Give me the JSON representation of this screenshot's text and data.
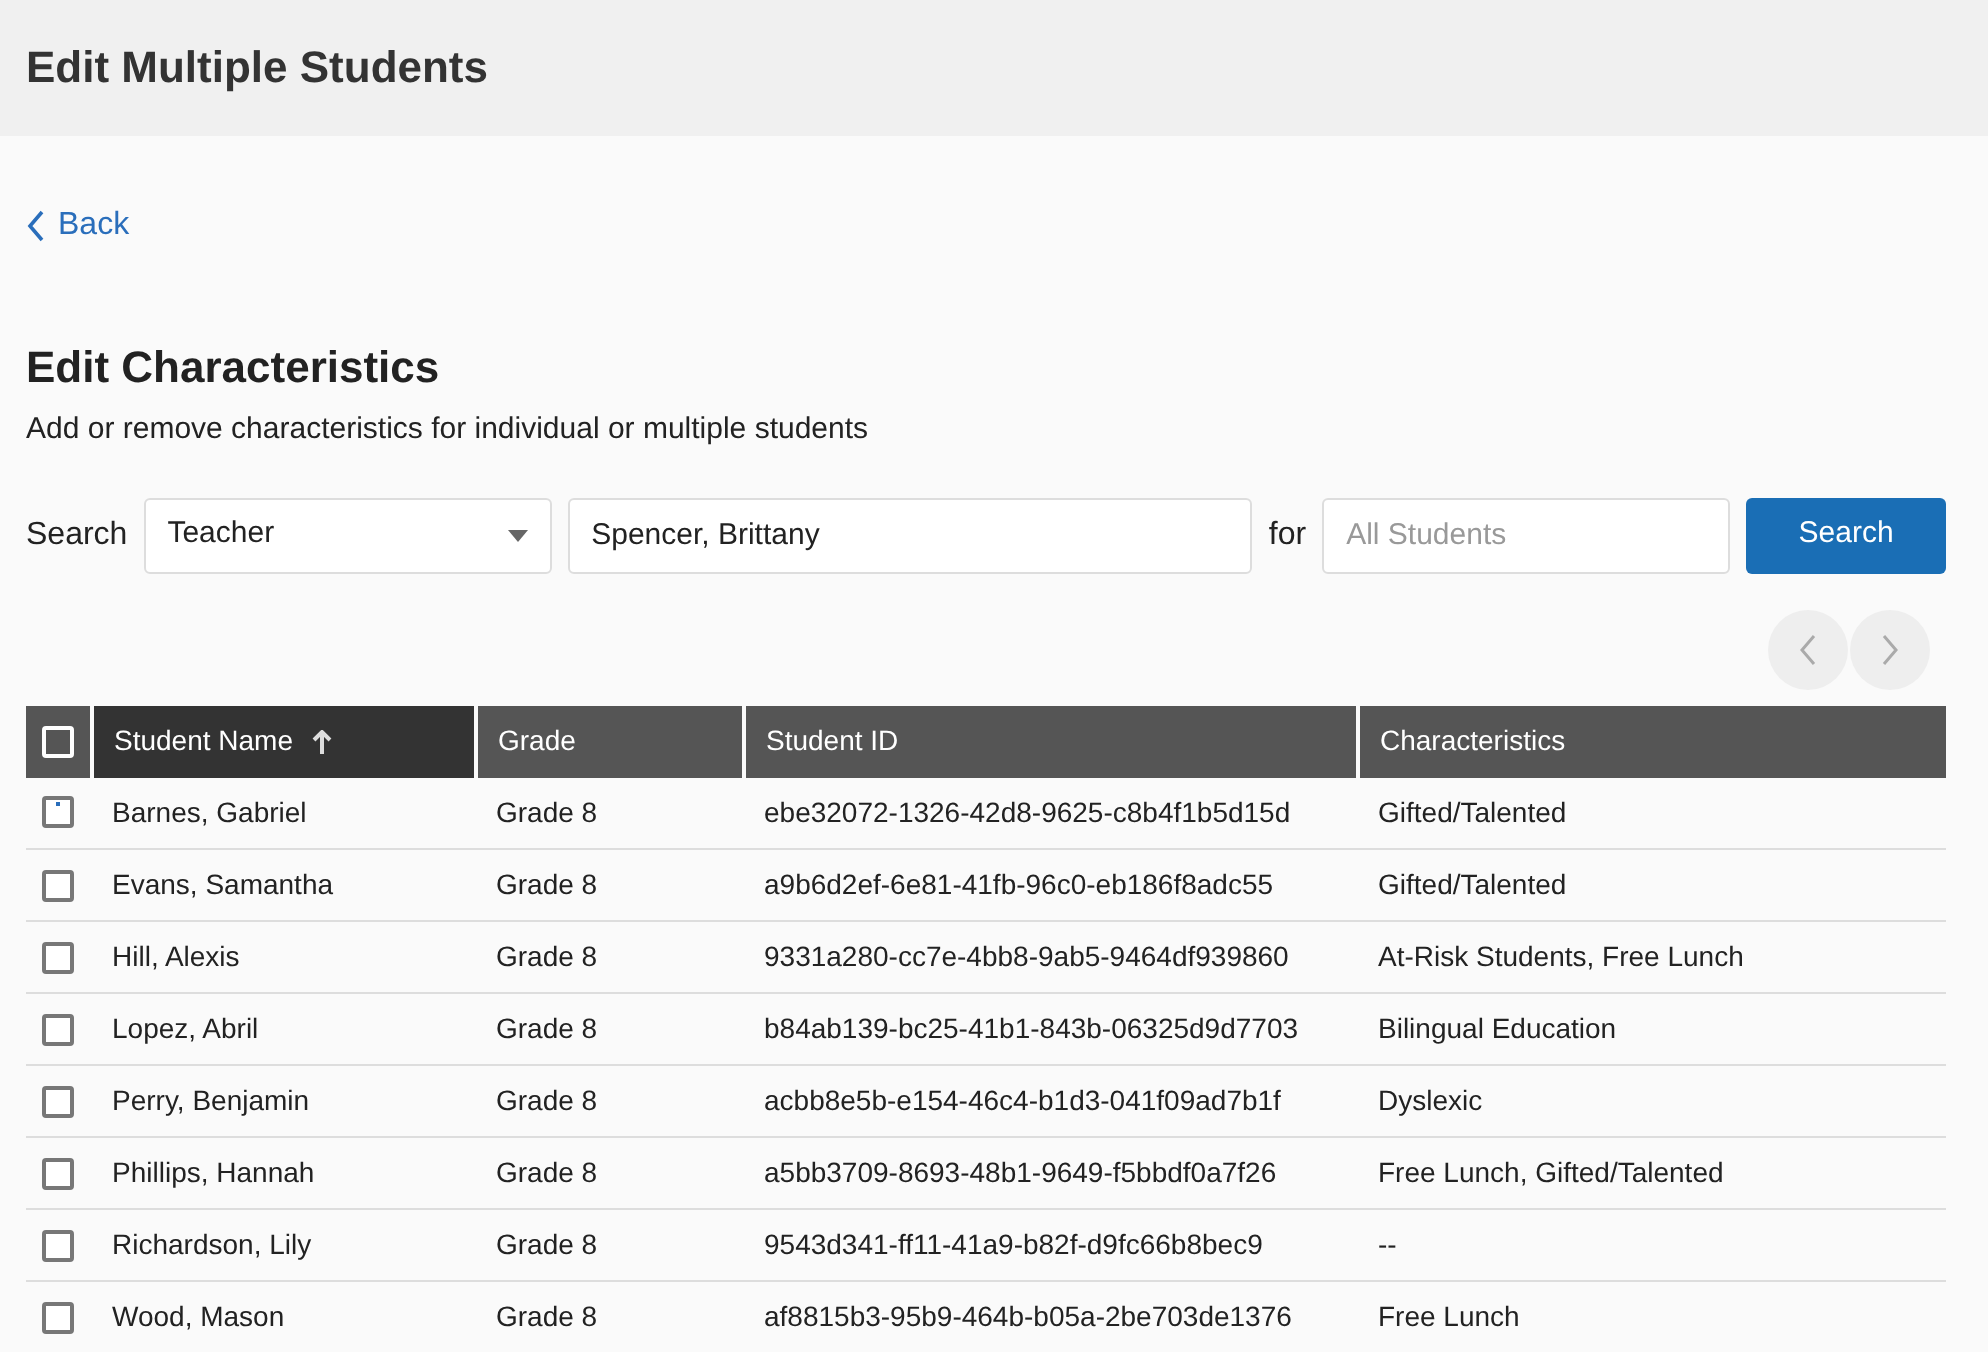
{
  "header": {
    "title": "Edit Multiple Students"
  },
  "back_link": "Back",
  "heading": "Edit Characteristics",
  "subtitle": "Add or remove characteristics for individual or multiple students",
  "search": {
    "label": "Search",
    "type_select": "Teacher",
    "value": "Spencer, Brittany",
    "for_label": "for",
    "scope_placeholder": "All Students",
    "button": "Search"
  },
  "table": {
    "select_all_checked": false,
    "columns": [
      {
        "label": "Student Name",
        "sorted": true
      },
      {
        "label": "Grade",
        "sorted": false
      },
      {
        "label": "Student ID",
        "sorted": false
      },
      {
        "label": "Characteristics",
        "sorted": false
      }
    ],
    "rows": [
      {
        "checked": false,
        "focused": true,
        "cells": [
          "Barnes, Gabriel",
          "Grade 8",
          "ebe32072-1326-42d8-9625-c8b4f1b5d15d",
          "Gifted/Talented"
        ]
      },
      {
        "checked": false,
        "focused": false,
        "cells": [
          "Evans, Samantha",
          "Grade 8",
          "a9b6d2ef-6e81-41fb-96c0-eb186f8adc55",
          "Gifted/Talented"
        ]
      },
      {
        "checked": false,
        "focused": false,
        "cells": [
          "Hill, Alexis",
          "Grade 8",
          "9331a280-cc7e-4bb8-9ab5-9464df939860",
          "At-Risk Students, Free Lunch"
        ]
      },
      {
        "checked": false,
        "focused": false,
        "cells": [
          "Lopez, Abril",
          "Grade 8",
          "b84ab139-bc25-41b1-843b-06325d9d7703",
          "Bilingual Education"
        ]
      },
      {
        "checked": false,
        "focused": false,
        "cells": [
          "Perry, Benjamin",
          "Grade 8",
          "acbb8e5b-e154-46c4-b1d3-041f09ad7b1f",
          "Dyslexic"
        ]
      },
      {
        "checked": false,
        "focused": false,
        "cells": [
          "Phillips, Hannah",
          "Grade 8",
          "a5bb3709-8693-48b1-9649-f5bbdf0a7f26",
          "Free Lunch, Gifted/Talented"
        ]
      },
      {
        "checked": false,
        "focused": false,
        "cells": [
          "Richardson, Lily",
          "Grade 8",
          "9543d341-ff11-41a9-b82f-d9fc66b8bec9",
          "--"
        ]
      },
      {
        "checked": false,
        "focused": false,
        "cells": [
          "Wood, Mason",
          "Grade 8",
          "af8815b3-95b9-464b-b05a-2be703de1376",
          "Free Lunch"
        ]
      }
    ]
  }
}
